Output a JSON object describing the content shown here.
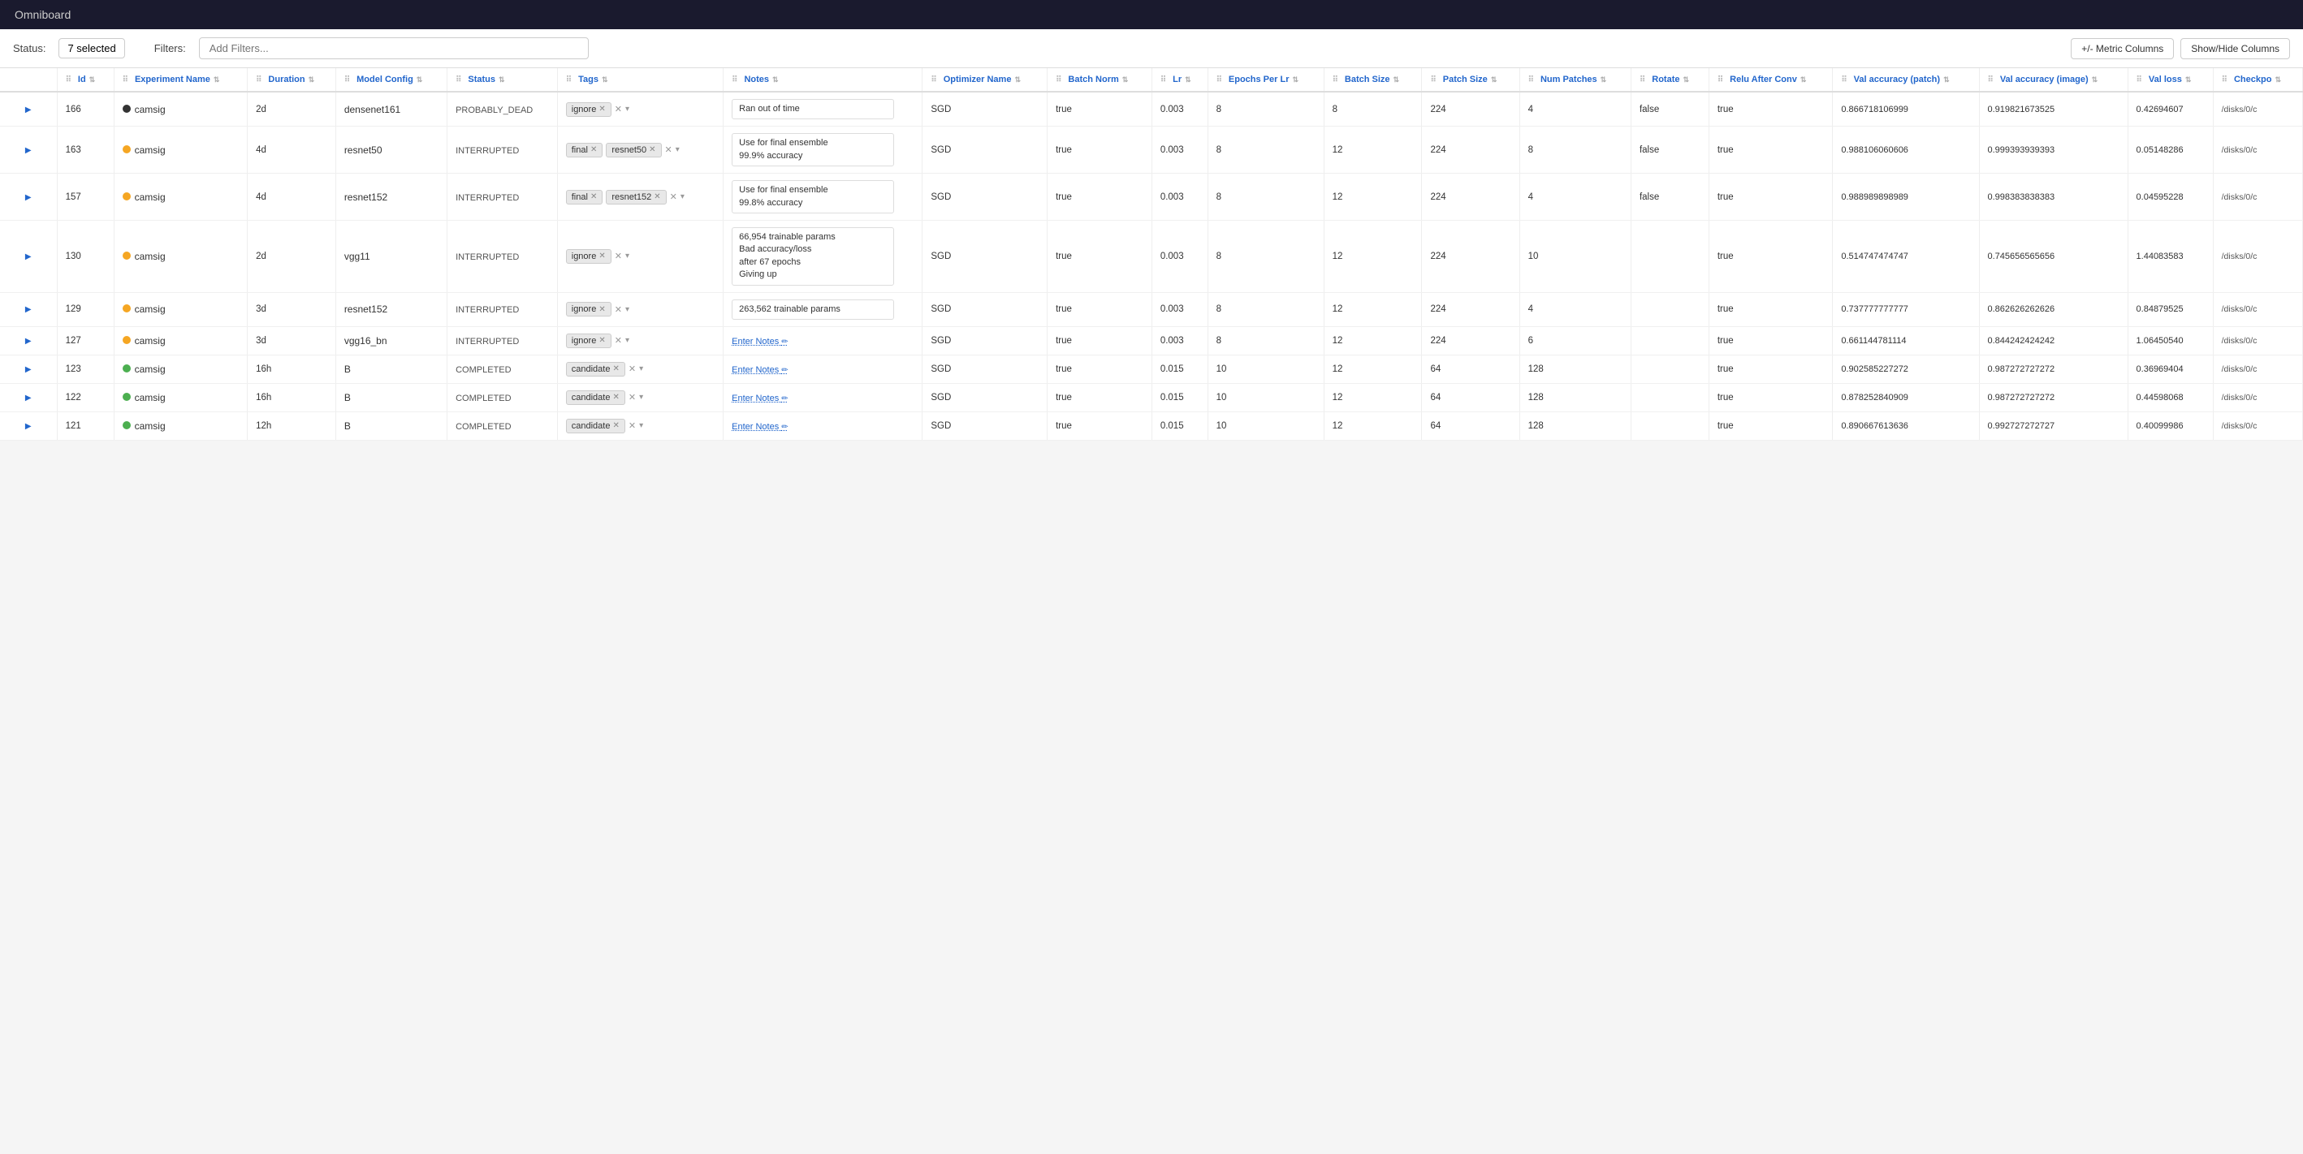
{
  "app": {
    "title": "Omniboard"
  },
  "toolbar": {
    "status_label": "Status:",
    "selected_label": "7 selected",
    "filters_label": "Filters:",
    "filters_placeholder": "Add Filters...",
    "metric_columns_btn": "+/- Metric Columns",
    "show_hide_btn": "Show/Hide Columns"
  },
  "columns": [
    {
      "id": "id",
      "label": "Id"
    },
    {
      "id": "exp_name",
      "label": "Experiment Name"
    },
    {
      "id": "duration",
      "label": "Duration"
    },
    {
      "id": "model_config",
      "label": "Model Config"
    },
    {
      "id": "status",
      "label": "Status"
    },
    {
      "id": "tags",
      "label": "Tags"
    },
    {
      "id": "notes",
      "label": "Notes"
    },
    {
      "id": "optimizer_name",
      "label": "Optimizer Name"
    },
    {
      "id": "batch_norm",
      "label": "Batch Norm"
    },
    {
      "id": "lr",
      "label": "Lr"
    },
    {
      "id": "epochs_per_lr",
      "label": "Epochs Per Lr"
    },
    {
      "id": "batch_size",
      "label": "Batch Size"
    },
    {
      "id": "patch_size",
      "label": "Patch Size"
    },
    {
      "id": "num_patches",
      "label": "Num Patches"
    },
    {
      "id": "rotate",
      "label": "Rotate"
    },
    {
      "id": "relu_after_conv",
      "label": "Relu After Conv"
    },
    {
      "id": "val_acc_patch",
      "label": "Val accuracy (patch)"
    },
    {
      "id": "val_acc_image",
      "label": "Val accuracy (image)"
    },
    {
      "id": "val_loss",
      "label": "Val loss"
    },
    {
      "id": "checkpoint",
      "label": "Checkpo"
    }
  ],
  "rows": [
    {
      "id": 166,
      "dot_color": "#333333",
      "exp_name": "camsig",
      "duration": "2d",
      "model_config": "densenet161",
      "status": "PROBABLY_DEAD",
      "tags": [
        {
          "label": "ignore"
        }
      ],
      "notes_type": "text",
      "notes": "Ran out of time",
      "optimizer": "SGD",
      "batch_norm": "true",
      "lr": "0.003",
      "epochs_per_lr": 8,
      "batch_size": 8,
      "patch_size": 224,
      "num_patches": 4,
      "rotate": "false",
      "relu_after_conv": "true",
      "val_acc_patch": "0.866718106999",
      "val_acc_image": "0.919821673525",
      "val_loss": "0.42694607",
      "checkpoint": "/disks/0/c"
    },
    {
      "id": 163,
      "dot_color": "#f5a623",
      "exp_name": "camsig",
      "duration": "4d",
      "model_config": "resnet50",
      "status": "INTERRUPTED",
      "tags": [
        {
          "label": "final"
        },
        {
          "label": "resnet50"
        }
      ],
      "notes_type": "text",
      "notes": "Use for final ensemble\n99.9% accuracy",
      "optimizer": "SGD",
      "batch_norm": "true",
      "lr": "0.003",
      "epochs_per_lr": 8,
      "batch_size": 12,
      "patch_size": 224,
      "num_patches": 8,
      "rotate": "false",
      "relu_after_conv": "true",
      "val_acc_patch": "0.988106060606",
      "val_acc_image": "0.999393939393",
      "val_loss": "0.05148286",
      "checkpoint": "/disks/0/c"
    },
    {
      "id": 157,
      "dot_color": "#f5a623",
      "exp_name": "camsig",
      "duration": "4d",
      "model_config": "resnet152",
      "status": "INTERRUPTED",
      "tags": [
        {
          "label": "final"
        },
        {
          "label": "resnet152"
        }
      ],
      "notes_type": "text",
      "notes": "Use for final ensemble\n99.8% accuracy",
      "optimizer": "SGD",
      "batch_norm": "true",
      "lr": "0.003",
      "epochs_per_lr": 8,
      "batch_size": 12,
      "patch_size": 224,
      "num_patches": 4,
      "rotate": "false",
      "relu_after_conv": "true",
      "val_acc_patch": "0.988989898989",
      "val_acc_image": "0.998383838383",
      "val_loss": "0.04595228",
      "checkpoint": "/disks/0/c"
    },
    {
      "id": 130,
      "dot_color": "#f5a623",
      "exp_name": "camsig",
      "duration": "2d",
      "model_config": "vgg11",
      "status": "INTERRUPTED",
      "tags": [
        {
          "label": "ignore"
        }
      ],
      "notes_type": "text",
      "notes": "66,954 trainable params\nBad accuracy/loss\nafter 67 epochs\nGiving up",
      "optimizer": "SGD",
      "batch_norm": "true",
      "lr": "0.003",
      "epochs_per_lr": 8,
      "batch_size": 12,
      "patch_size": 224,
      "num_patches": 10,
      "rotate": "",
      "relu_after_conv": "true",
      "val_acc_patch": "0.514747474747",
      "val_acc_image": "0.745656565656",
      "val_loss": "1.44083583",
      "checkpoint": "/disks/0/c"
    },
    {
      "id": 129,
      "dot_color": "#f5a623",
      "exp_name": "camsig",
      "duration": "3d",
      "model_config": "resnet152",
      "status": "INTERRUPTED",
      "tags": [
        {
          "label": "ignore"
        }
      ],
      "notes_type": "text",
      "notes": "263,562 trainable params",
      "optimizer": "SGD",
      "batch_norm": "true",
      "lr": "0.003",
      "epochs_per_lr": 8,
      "batch_size": 12,
      "patch_size": 224,
      "num_patches": 4,
      "rotate": "",
      "relu_after_conv": "true",
      "val_acc_patch": "0.737777777777",
      "val_acc_image": "0.862626262626",
      "val_loss": "0.84879525",
      "checkpoint": "/disks/0/c"
    },
    {
      "id": 127,
      "dot_color": "#f5a623",
      "exp_name": "camsig",
      "duration": "3d",
      "model_config": "vgg16_bn",
      "status": "INTERRUPTED",
      "tags": [
        {
          "label": "ignore"
        }
      ],
      "notes_type": "enter",
      "notes": "Enter Notes",
      "optimizer": "SGD",
      "batch_norm": "true",
      "lr": "0.003",
      "epochs_per_lr": 8,
      "batch_size": 12,
      "patch_size": 224,
      "num_patches": 6,
      "rotate": "",
      "relu_after_conv": "true",
      "val_acc_patch": "0.661144781114",
      "val_acc_image": "0.844242424242",
      "val_loss": "1.06450540",
      "checkpoint": "/disks/0/c"
    },
    {
      "id": 123,
      "dot_color": "#4caf50",
      "exp_name": "camsig",
      "duration": "16h",
      "model_config": "B",
      "status": "COMPLETED",
      "tags": [
        {
          "label": "candidate"
        }
      ],
      "notes_type": "enter",
      "notes": "Enter Notes",
      "optimizer": "SGD",
      "batch_norm": "true",
      "lr": "0.015",
      "epochs_per_lr": 10,
      "batch_size": 12,
      "patch_size": 64,
      "num_patches": 128,
      "rotate": "",
      "relu_after_conv": "true",
      "val_acc_patch": "0.902585227272",
      "val_acc_image": "0.987272727272",
      "val_loss": "0.36969404",
      "checkpoint": "/disks/0/c"
    },
    {
      "id": 122,
      "dot_color": "#4caf50",
      "exp_name": "camsig",
      "duration": "16h",
      "model_config": "B",
      "status": "COMPLETED",
      "tags": [
        {
          "label": "candidate"
        }
      ],
      "notes_type": "enter",
      "notes": "Enter Notes",
      "optimizer": "SGD",
      "batch_norm": "true",
      "lr": "0.015",
      "epochs_per_lr": 10,
      "batch_size": 12,
      "patch_size": 64,
      "num_patches": 128,
      "rotate": "",
      "relu_after_conv": "true",
      "val_acc_patch": "0.878252840909",
      "val_acc_image": "0.987272727272",
      "val_loss": "0.44598068",
      "checkpoint": "/disks/0/c"
    },
    {
      "id": 121,
      "dot_color": "#4caf50",
      "exp_name": "camsig",
      "duration": "12h",
      "model_config": "B",
      "status": "COMPLETED",
      "tags": [
        {
          "label": "candidate"
        }
      ],
      "notes_type": "enter",
      "notes": "Enter Notes",
      "optimizer": "SGD",
      "batch_norm": "true",
      "lr": "0.015",
      "epochs_per_lr": 10,
      "batch_size": 12,
      "patch_size": 64,
      "num_patches": 128,
      "rotate": "",
      "relu_after_conv": "true",
      "val_acc_patch": "0.890667613636",
      "val_acc_image": "0.992727272727",
      "val_loss": "0.40099986",
      "checkpoint": "/disks/0/c"
    }
  ]
}
